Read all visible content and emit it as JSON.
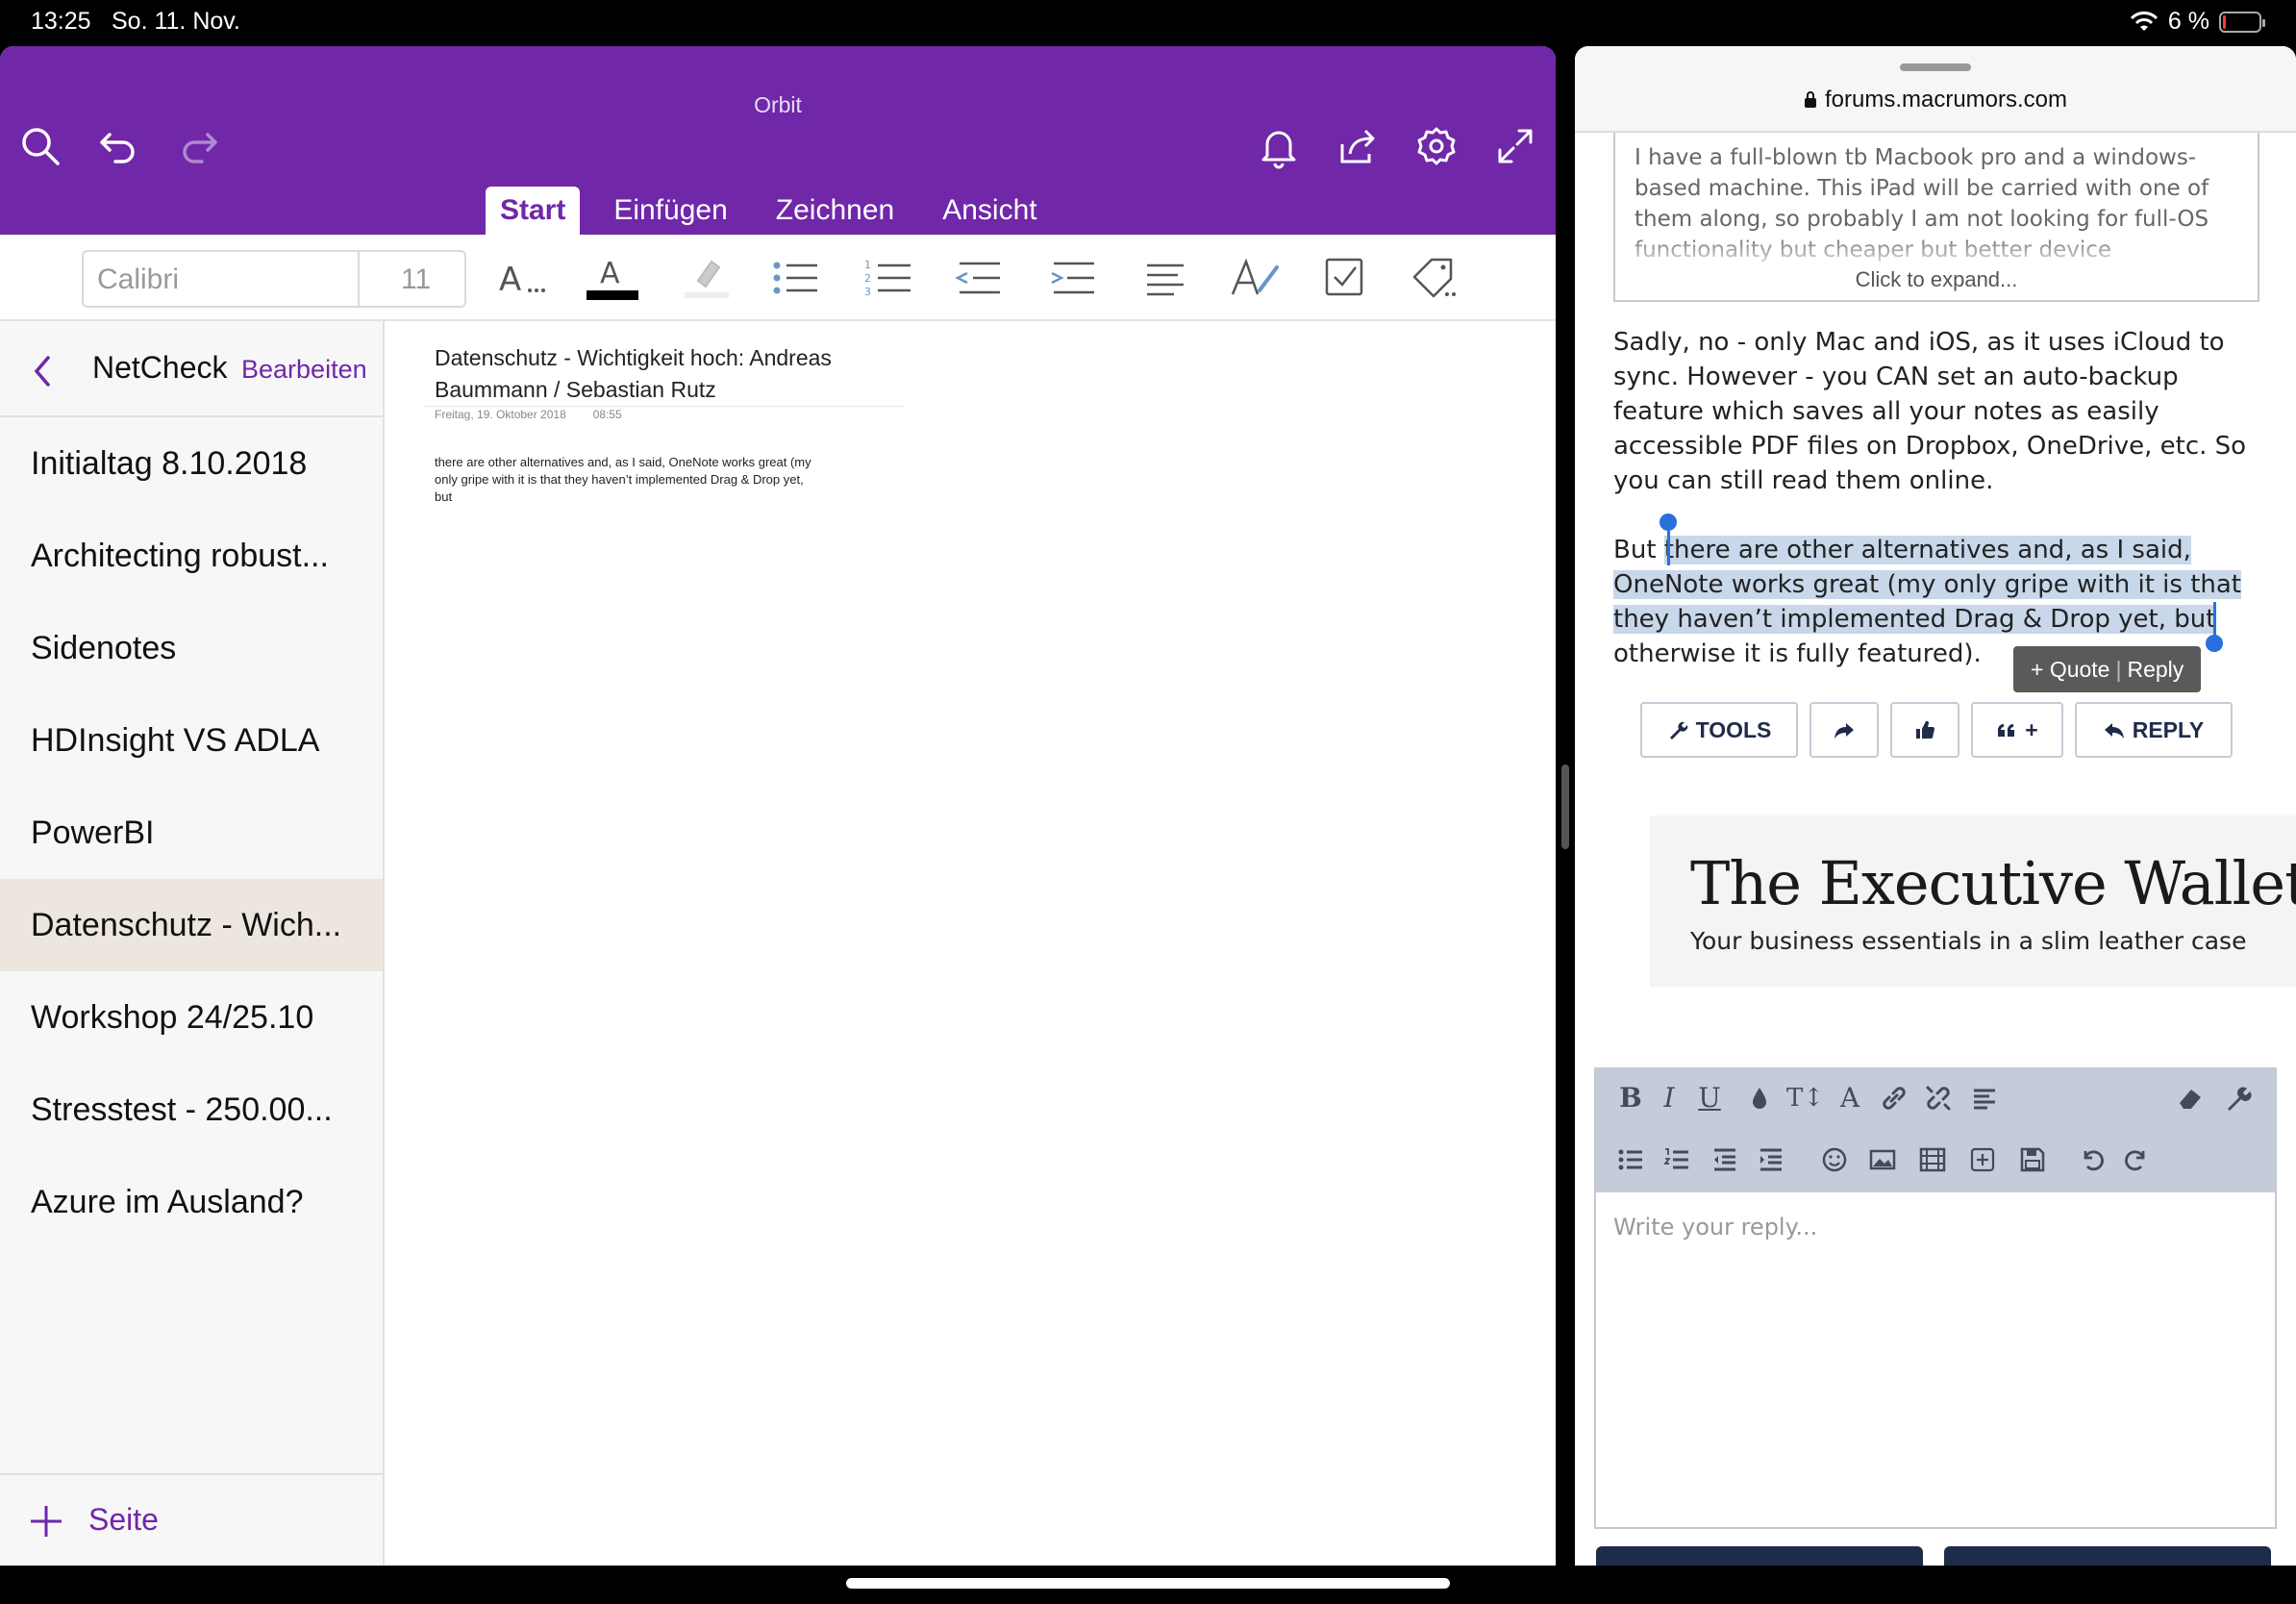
{
  "status_bar": {
    "time": "13:25",
    "date": "So. 11. Nov.",
    "battery": "6 %",
    "battery_level": 0.06
  },
  "onenote": {
    "title": "Orbit",
    "tabs": [
      "Start",
      "Einfügen",
      "Zeichnen",
      "Ansicht"
    ],
    "active_tab": "Start",
    "ribbon": {
      "font_name": "Calibri",
      "font_size": "11",
      "text_color": "#000000"
    },
    "sidebar": {
      "section": "NetCheck",
      "edit_label": "Bearbeiten",
      "pages": [
        "Initialtag 8.10.2018",
        "Architecting robust...",
        "Sidenotes",
        "HDInsight VS ADLA",
        "PowerBI",
        "Datenschutz - Wich...",
        "Workshop 24/25.10",
        "Stresstest - 250.00...",
        "Azure im Ausland?"
      ],
      "selected_index": 5,
      "add_page_label": "Seite"
    },
    "page": {
      "title": "Datenschutz - Wichtigkeit hoch: Andreas Baummann / Sebastian Rutz",
      "date": "Freitag, 19. Oktober 2018",
      "time": "08:55",
      "body": "there are other alternatives and, as I said, OneNote works great (my only gripe with it is that they haven’t implemented Drag & Drop yet, but"
    },
    "brand_color": "#7027a8"
  },
  "safari": {
    "url": "forums.macrumors.com",
    "quote": {
      "text": "I have a full-blown tb Macbook pro and a windows-based machine. This iPad will be carried with one of them along, so probably I am not looking for full-OS functionality but cheaper but better device",
      "expand_label": "Click to expand..."
    },
    "post": {
      "para1": "Sadly, no - only Mac and iOS, as it uses iCloud to sync. However - you CAN set an auto-backup feature which saves all your notes as easily accessible PDF files on Dropbox, OneDrive, etc. So you can still read them online.",
      "para2_before": "But ",
      "para2_selected": "there are other alternatives and, as I said, OneNote works great (my only gripe with it is that they haven’t implemented Drag & Drop yet, but",
      "para2_after": " otherwise it is fully featured)."
    },
    "selection_popup": {
      "quote": "+ Quote",
      "reply": "Reply"
    },
    "actions": {
      "tools": "TOOLS",
      "reply": "REPLY",
      "multiquote": "+"
    },
    "ad": {
      "title": "The Executive Wallet",
      "subtitle": "Your business essentials in a slim leather case"
    },
    "editor": {
      "toolbar_row1": [
        "bold",
        "italic",
        "underline",
        "color",
        "font-size",
        "font-family",
        "link",
        "unlink",
        "align"
      ],
      "toolbar_row2": [
        "bullet-list",
        "numbered-list",
        "outdent",
        "indent",
        "smilies",
        "image",
        "media",
        "insert",
        "save",
        "undo",
        "redo"
      ],
      "placeholder": "Write your reply..."
    }
  }
}
